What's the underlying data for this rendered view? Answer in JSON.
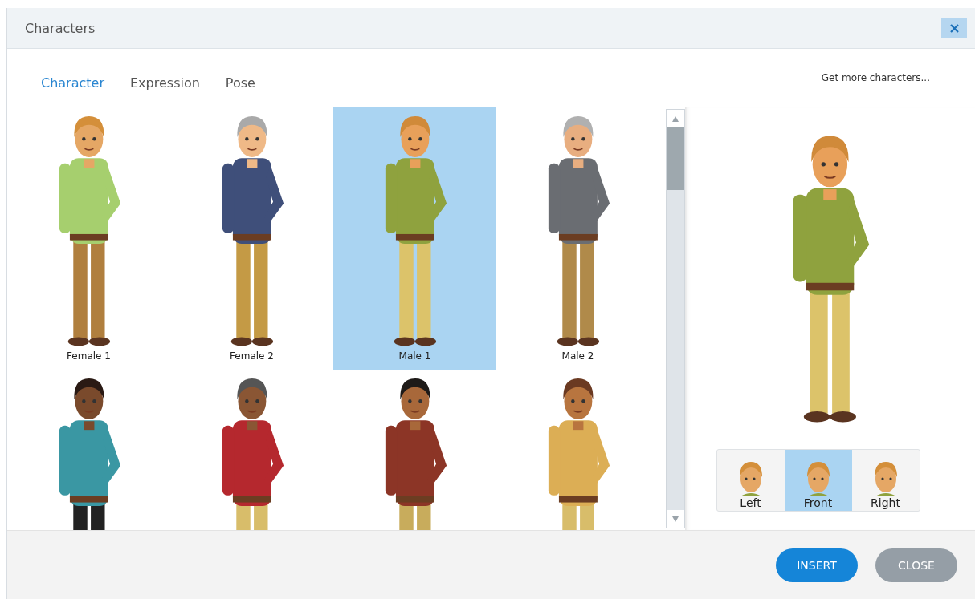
{
  "window": {
    "title": "Characters"
  },
  "tabs": [
    {
      "label": "Character",
      "selected": true
    },
    {
      "label": "Expression",
      "selected": false
    },
    {
      "label": "Pose",
      "selected": false
    }
  ],
  "more_link": "Get more characters...",
  "characters": [
    {
      "label": "Female 1",
      "selected": false,
      "color": "#a6cf6e"
    },
    {
      "label": "Female 2",
      "selected": false,
      "color": "#3f4f7a"
    },
    {
      "label": "Male 1",
      "selected": true,
      "color": "#8fa23e"
    },
    {
      "label": "Male 2",
      "selected": false,
      "color": "#6a6d72"
    },
    {
      "selected": false,
      "color": "#3a97a3"
    },
    {
      "selected": false,
      "color": "#b5282e"
    },
    {
      "selected": false,
      "color": "#8c3526"
    },
    {
      "selected": false,
      "color": "#dcae55"
    }
  ],
  "preview": {
    "color": "#8fa23e"
  },
  "views": [
    {
      "label": "Left",
      "selected": false
    },
    {
      "label": "Front",
      "selected": true
    },
    {
      "label": "Right",
      "selected": false
    }
  ],
  "buttons": [
    {
      "label": "INSERT",
      "kind": "primary"
    },
    {
      "label": "CLOSE",
      "kind": "secondary"
    }
  ]
}
